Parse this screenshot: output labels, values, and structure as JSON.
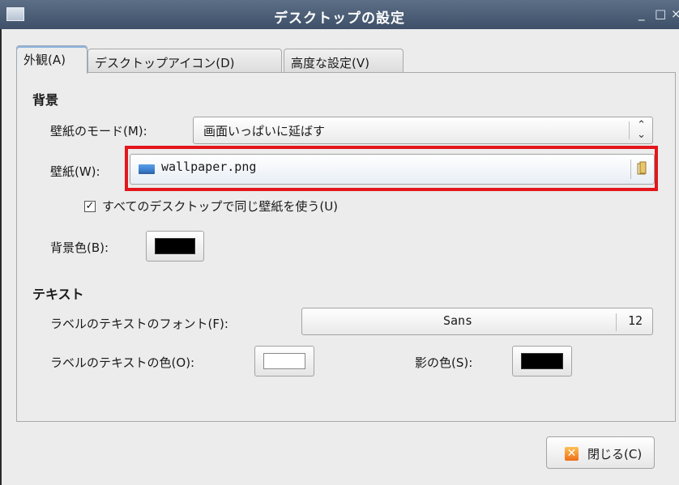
{
  "window": {
    "title": "デスクトップの設定",
    "controls": [
      "_",
      "□",
      "×"
    ]
  },
  "tabs": [
    {
      "label": "外観(A)",
      "active": true
    },
    {
      "label": "デスクトップアイコン(D)",
      "active": false
    },
    {
      "label": "高度な設定(V)",
      "active": false
    }
  ],
  "background": {
    "heading": "背景",
    "mode_label": "壁紙のモード(M):",
    "mode_value": "画面いっぱいに延ばす",
    "wallpaper_label": "壁紙(W):",
    "wallpaper_file": "wallpaper.png",
    "same_wallpaper_label": "すべてのデスクトップで同じ壁紙を使う(U)",
    "same_wallpaper_checked": true,
    "bg_color_label": "背景色(B):",
    "bg_color": "#000000"
  },
  "text": {
    "heading": "テキスト",
    "font_label": "ラベルのテキストのフォント(F):",
    "font_name": "Sans",
    "font_size": "12",
    "text_color_label": "ラベルのテキストの色(O):",
    "text_color": "#ffffff",
    "shadow_color_label": "影の色(S):",
    "shadow_color": "#000000"
  },
  "close_button": {
    "label": "閉じる(C)"
  },
  "colors": {
    "highlight": "#e3161c",
    "titlebar": "#4a5b73"
  },
  "icons": {
    "window_icon": "window-icon",
    "mode_combo": "up-down-arrows-icon",
    "file_thumb": "image-file-icon",
    "file_chooser": "folder-open-icon",
    "close": "close-x-icon"
  }
}
